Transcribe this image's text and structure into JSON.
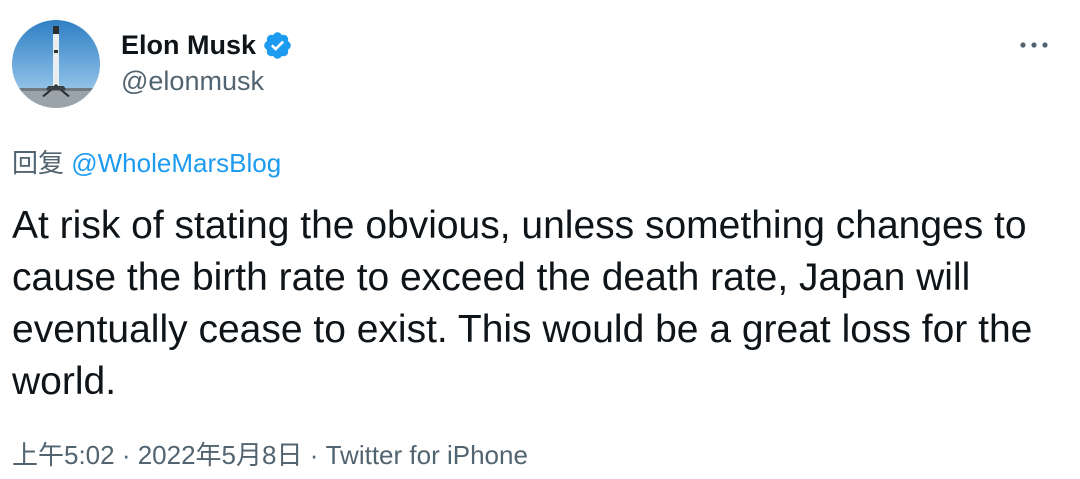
{
  "author": {
    "display_name": "Elon Musk",
    "handle": "@elonmusk",
    "verified": true,
    "avatar_icon": "rocket-launch-avatar"
  },
  "reply": {
    "prefix": "回复",
    "mention": "@WholeMarsBlog"
  },
  "tweet": {
    "text": "At risk of stating the obvious, unless something changes to cause the birth rate to exceed the death rate, Japan will eventually cease to exist. This would be a great loss for the world."
  },
  "meta": {
    "time": "上午5:02",
    "separator": " · ",
    "date": "2022年5月8日",
    "source": "Twitter for iPhone"
  },
  "colors": {
    "accent": "#1d9bf0",
    "text_primary": "#0f1419",
    "text_secondary": "#536471"
  },
  "icons": {
    "more": "more-horizontal-icon",
    "verified": "verified-badge-icon"
  }
}
